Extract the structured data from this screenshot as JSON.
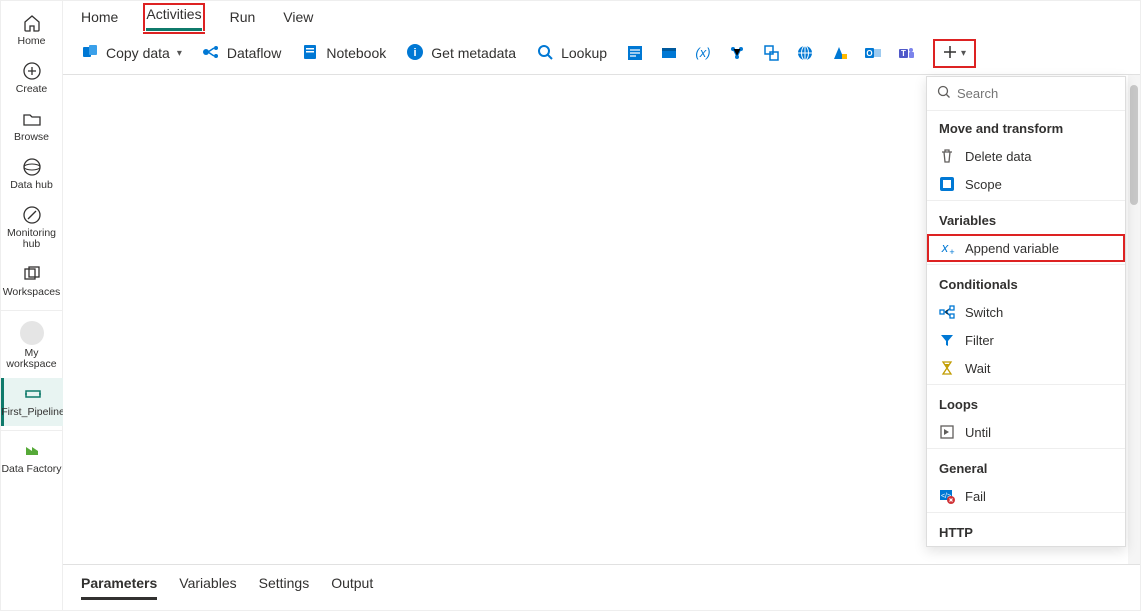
{
  "sidebar": {
    "items": [
      {
        "label": "Home",
        "icon": "home"
      },
      {
        "label": "Create",
        "icon": "plus-circle"
      },
      {
        "label": "Browse",
        "icon": "folder"
      },
      {
        "label": "Data hub",
        "icon": "data-hub"
      },
      {
        "label": "Monitoring hub",
        "icon": "monitor"
      },
      {
        "label": "Workspaces",
        "icon": "workspaces"
      }
    ],
    "my_workspace_label": "My workspace",
    "pipeline_label": "First_Pipeline",
    "product_label": "Data Factory"
  },
  "tabs": [
    {
      "label": "Home"
    },
    {
      "label": "Activities",
      "active": true,
      "highlight": true
    },
    {
      "label": "Run"
    },
    {
      "label": "View"
    }
  ],
  "toolbar": {
    "copy_data": "Copy data",
    "dataflow": "Dataflow",
    "notebook": "Notebook",
    "get_metadata": "Get metadata",
    "lookup": "Lookup"
  },
  "toolbar_icons": [
    "script-icon",
    "spark-job-icon",
    "variable-icon",
    "ml-icon",
    "procedure-icon",
    "web-icon",
    "azure-icon",
    "outlook-icon",
    "teams-icon"
  ],
  "search": {
    "placeholder": "Search"
  },
  "panel": {
    "sections": [
      {
        "label": "Move and transform",
        "items": [
          {
            "label": "Delete data",
            "icon": "trash",
            "color": "#605e5c"
          },
          {
            "label": "Scope",
            "icon": "scope",
            "color": "#0078d4"
          }
        ]
      },
      {
        "label": "Variables",
        "items": [
          {
            "label": "Append variable",
            "icon": "var-plus",
            "color": "#0078d4",
            "highlight": true
          }
        ]
      },
      {
        "label": "Conditionals",
        "items": [
          {
            "label": "Switch",
            "icon": "switch",
            "color": "#0078d4"
          },
          {
            "label": "Filter",
            "icon": "filter",
            "color": "#0078d4"
          },
          {
            "label": "Wait",
            "icon": "wait",
            "color": "#c19c00"
          }
        ]
      },
      {
        "label": "Loops",
        "items": [
          {
            "label": "Until",
            "icon": "until",
            "color": "#605e5c"
          }
        ]
      },
      {
        "label": "General",
        "items": [
          {
            "label": "Fail",
            "icon": "fail",
            "color": "#d13438"
          }
        ]
      },
      {
        "label": "HTTP",
        "items": []
      }
    ]
  },
  "bottom_tabs": [
    {
      "label": "Parameters",
      "active": true
    },
    {
      "label": "Variables"
    },
    {
      "label": "Settings"
    },
    {
      "label": "Output"
    }
  ]
}
